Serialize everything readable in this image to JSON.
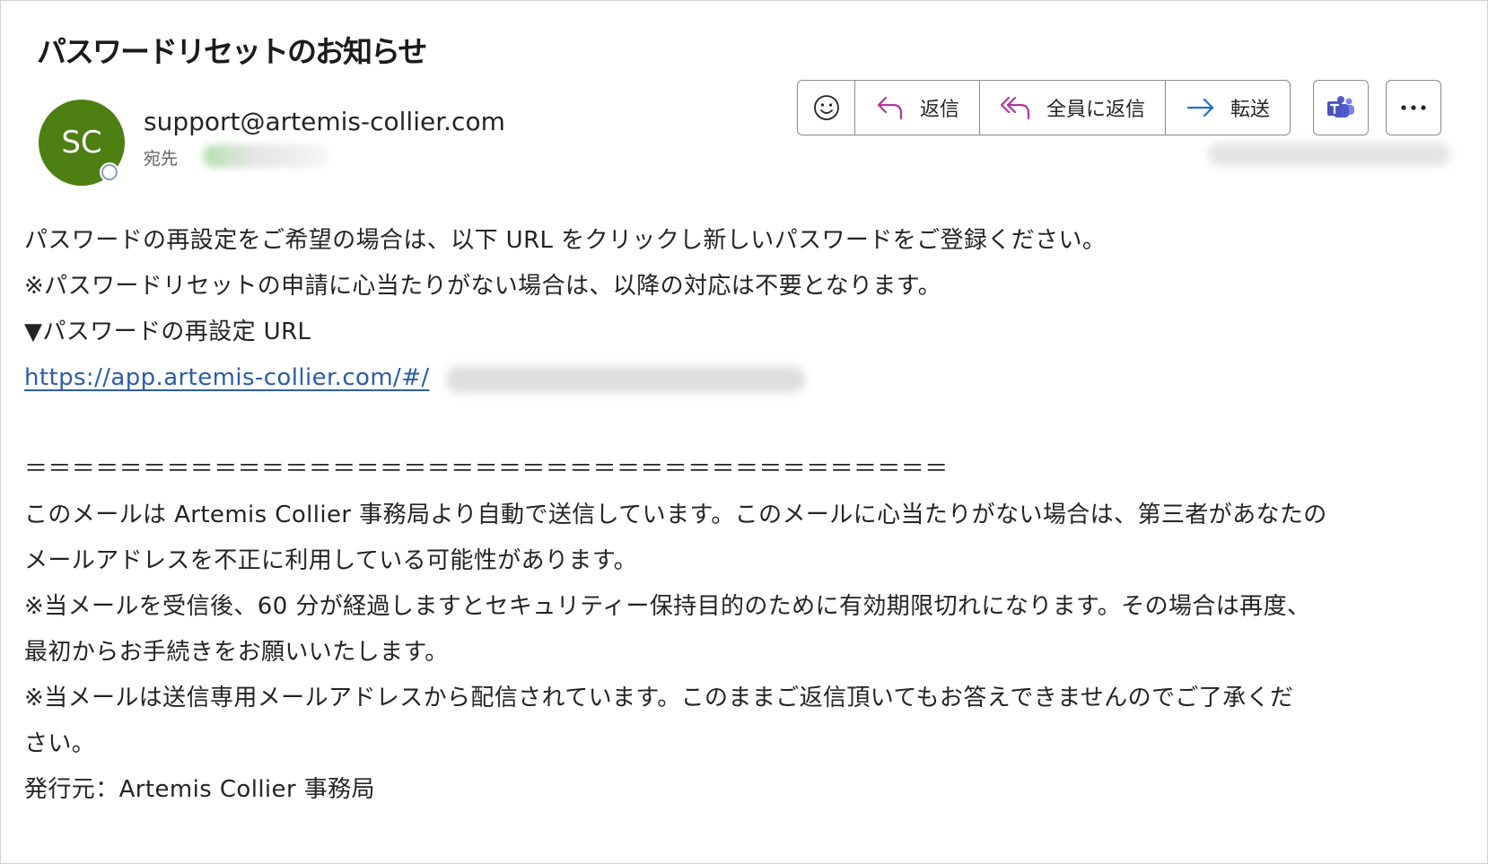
{
  "email": {
    "subject": "パスワードリセットのお知らせ",
    "avatar_initials": "SC",
    "sender": "support@artemis-collier.com",
    "to_label": "宛先"
  },
  "toolbar": {
    "emoji_icon": "smiley-icon",
    "reply_label": "返信",
    "reply_all_label": "全員に返信",
    "forward_label": "転送",
    "teams_icon": "teams-icon",
    "more_icon": "more-horizontal-icon"
  },
  "colors": {
    "avatar": "#4e7f12",
    "reply_icon": "#b0369e",
    "forward_icon": "#1e6fd0",
    "link": "#2a5da8",
    "teams": "#5059c9"
  },
  "body": {
    "line1": "パスワードの再設定をご希望の場合は、以下 URL をクリックし新しいパスワードをご登録ください。",
    "line2": "※パスワードリセットの申請に心当たりがない場合は、以降の対応は不要となります。",
    "line3": "▼パスワードの再設定 URL",
    "url": "https://app.artemis-collier.com/#/",
    "separator": "＝＝＝＝＝＝＝＝＝＝＝＝＝＝＝＝＝＝＝＝＝＝＝＝＝＝＝＝＝＝＝＝＝＝＝＝＝＝＝",
    "line5a": "このメールは Artemis Collier 事務局より自動で送信しています。このメールに心当たりがない場合は、第三者があなたの",
    "line5b": "メールアドレスを不正に利用している可能性があります。",
    "line6a": "※当メールを受信後、60 分が経過しますとセキュリティー保持目的のために有効期限切れになります。その場合は再度、",
    "line6b": "最初からお手続きをお願いいたします。",
    "line7a": "※当メールは送信専用メールアドレスから配信されています。このままご返信頂いてもお答えできませんのでご了承くだ",
    "line7b": "さい。",
    "issuer": "発行元：Artemis Collier 事務局"
  }
}
